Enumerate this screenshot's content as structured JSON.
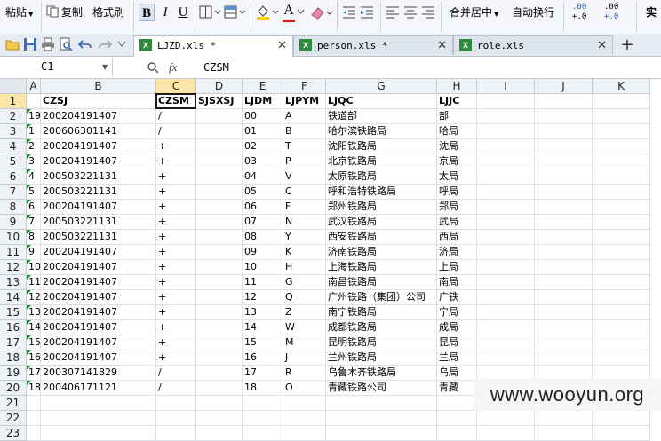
{
  "toolbar": {
    "paste": "粘贴",
    "copy": "复制",
    "format_painter": "格式刷",
    "bold": "B",
    "italic": "I",
    "underline": "U",
    "font_color_letter": "A",
    "merge_center": "合并居中",
    "wrap_text": "自动换行",
    "dec_increase": ".00",
    "dec_increase2": "+.0",
    "dec_decrease": ".00",
    "dec_decrease2": "+.0",
    "cut_off": "实"
  },
  "tabs": [
    {
      "name": "LJZD.xls *",
      "active": true
    },
    {
      "name": "person.xls *",
      "active": false
    },
    {
      "name": "role.xls",
      "active": false
    }
  ],
  "formula_bar": {
    "cell_ref": "C1",
    "fx": "fx",
    "value": "CZSM"
  },
  "columns": [
    "A",
    "B",
    "C",
    "D",
    "E",
    "F",
    "G",
    "H",
    "I",
    "J",
    "K"
  ],
  "selected": {
    "col": "C",
    "row": 1
  },
  "rows": [
    [
      "",
      "CZSJ",
      "CZSM",
      "SJSXSJ",
      "LJDM",
      "LJPYM",
      "LJQC",
      "LJJC"
    ],
    [
      "19",
      "200204191407",
      "/",
      "",
      "00",
      "A",
      "铁道部",
      "部"
    ],
    [
      "1",
      "200606301141",
      "/",
      "",
      "01",
      "B",
      "哈尔滨铁路局",
      "哈局"
    ],
    [
      "2",
      "200204191407",
      "+",
      "",
      "02",
      "T",
      "沈阳铁路局",
      "沈局"
    ],
    [
      "3",
      "200204191407",
      "+",
      "",
      "03",
      "P",
      "北京铁路局",
      "京局"
    ],
    [
      "4",
      "200503221131",
      "+",
      "",
      "04",
      "V",
      "太原铁路局",
      "太局"
    ],
    [
      "5",
      "200503221131",
      "+",
      "",
      "05",
      "C",
      "呼和浩特铁路局",
      "呼局"
    ],
    [
      "6",
      "200204191407",
      "+",
      "",
      "06",
      "F",
      "郑州铁路局",
      "郑局"
    ],
    [
      "7",
      "200503221131",
      "+",
      "",
      "07",
      "N",
      "武汉铁路局",
      "武局"
    ],
    [
      "8",
      "200503221131",
      "+",
      "",
      "08",
      "Y",
      "西安铁路局",
      "西局"
    ],
    [
      "9",
      "200204191407",
      "+",
      "",
      "09",
      "K",
      "济南铁路局",
      "济局"
    ],
    [
      "10",
      "200204191407",
      "+",
      "",
      "10",
      "H",
      "上海铁路局",
      "上局"
    ],
    [
      "11",
      "200204191407",
      "+",
      "",
      "11",
      "G",
      "南昌铁路局",
      "南局"
    ],
    [
      "12",
      "200204191407",
      "+",
      "",
      "12",
      "Q",
      "广州铁路（集团）公司",
      "广铁"
    ],
    [
      "13",
      "200204191407",
      "+",
      "",
      "13",
      "Z",
      "南宁铁路局",
      "宁局"
    ],
    [
      "14",
      "200204191407",
      "+",
      "",
      "14",
      "W",
      "成都铁路局",
      "成局"
    ],
    [
      "15",
      "200204191407",
      "+",
      "",
      "15",
      "M",
      "昆明铁路局",
      "昆局"
    ],
    [
      "16",
      "200204191407",
      "+",
      "",
      "16",
      "J",
      "兰州铁路局",
      "兰局"
    ],
    [
      "17",
      "200307141829",
      "/",
      "",
      "17",
      "R",
      "乌鲁木齐铁路局",
      "乌局"
    ],
    [
      "18",
      "200406171121",
      "/",
      "",
      "18",
      "O",
      "青藏铁路公司",
      "青藏"
    ],
    [
      "",
      "",
      "",
      "",
      "",
      "",
      "",
      ""
    ],
    [
      "",
      "",
      "",
      "",
      "",
      "",
      "",
      ""
    ],
    [
      "",
      "",
      "",
      "",
      "",
      "",
      "",
      ""
    ]
  ],
  "watermark": "www.wooyun.org",
  "colors": {
    "selection_header": "#fbe6a8",
    "indicator": "#1e8a2f",
    "tab_bg": "#e6ebf1"
  }
}
